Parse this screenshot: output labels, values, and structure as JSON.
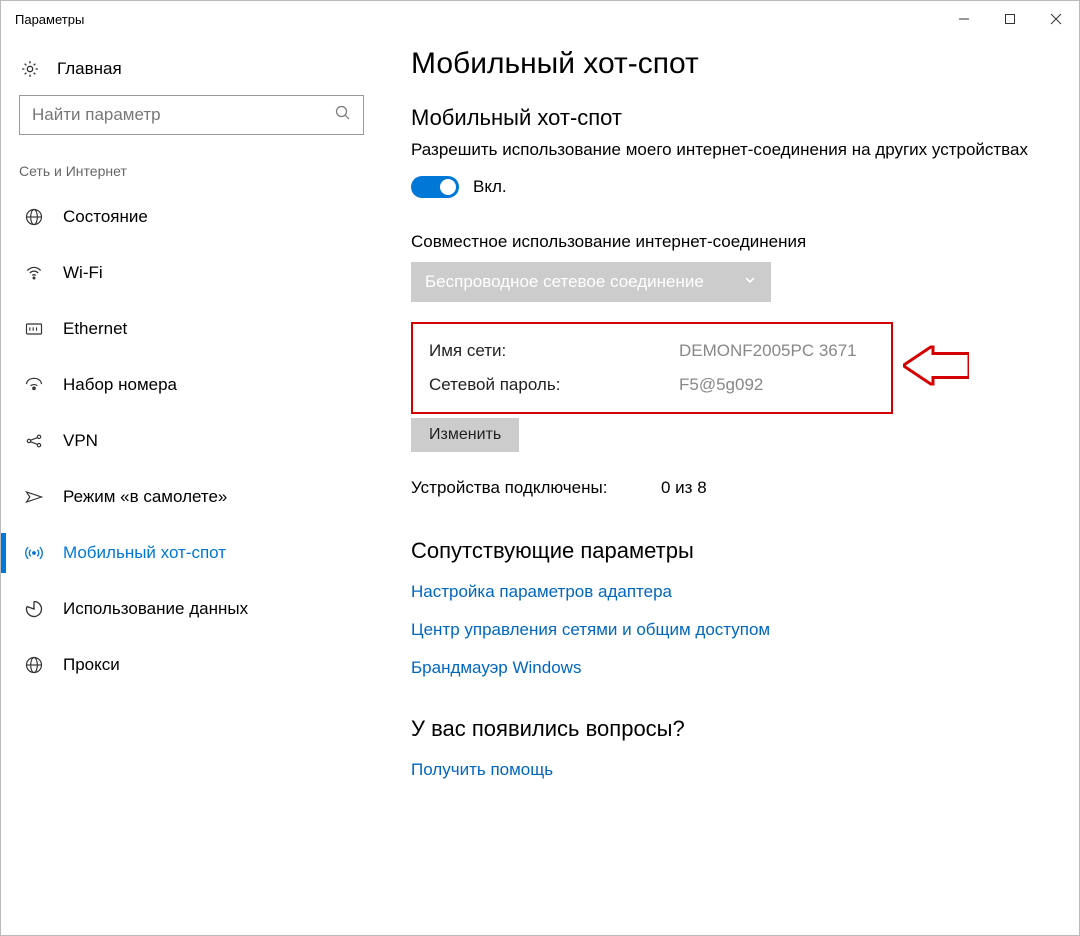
{
  "window": {
    "title": "Параметры"
  },
  "sidebar": {
    "home": "Главная",
    "search_placeholder": "Найти параметр",
    "section": "Сеть и Интернет",
    "items": [
      {
        "label": "Состояние"
      },
      {
        "label": "Wi-Fi"
      },
      {
        "label": "Ethernet"
      },
      {
        "label": "Набор номера"
      },
      {
        "label": "VPN"
      },
      {
        "label": "Режим «в самолете»"
      },
      {
        "label": "Мобильный хот-спот"
      },
      {
        "label": "Использование данных"
      },
      {
        "label": "Прокси"
      }
    ]
  },
  "main": {
    "title": "Мобильный хот-спот",
    "section_title": "Мобильный хот-спот",
    "description": "Разрешить использование моего интернет-соединения на других устройствах",
    "toggle_state": "Вкл.",
    "share_label": "Совместное использование интернет-соединения",
    "dropdown_value": "Беспроводное сетевое соединение",
    "network_name_label": "Имя сети:",
    "network_name_value": "DEMONF2005PC 3671",
    "password_label": "Сетевой пароль:",
    "password_value": "F5@5g092",
    "edit_button": "Изменить",
    "devices_label": "Устройства подключены:",
    "devices_value": "0 из 8",
    "related_title": "Сопутствующие параметры",
    "related_links": [
      "Настройка параметров адаптера",
      "Центр управления сетями и общим доступом",
      "Брандмауэр Windows"
    ],
    "help_title": "У вас появились вопросы?",
    "help_link": "Получить помощь"
  }
}
